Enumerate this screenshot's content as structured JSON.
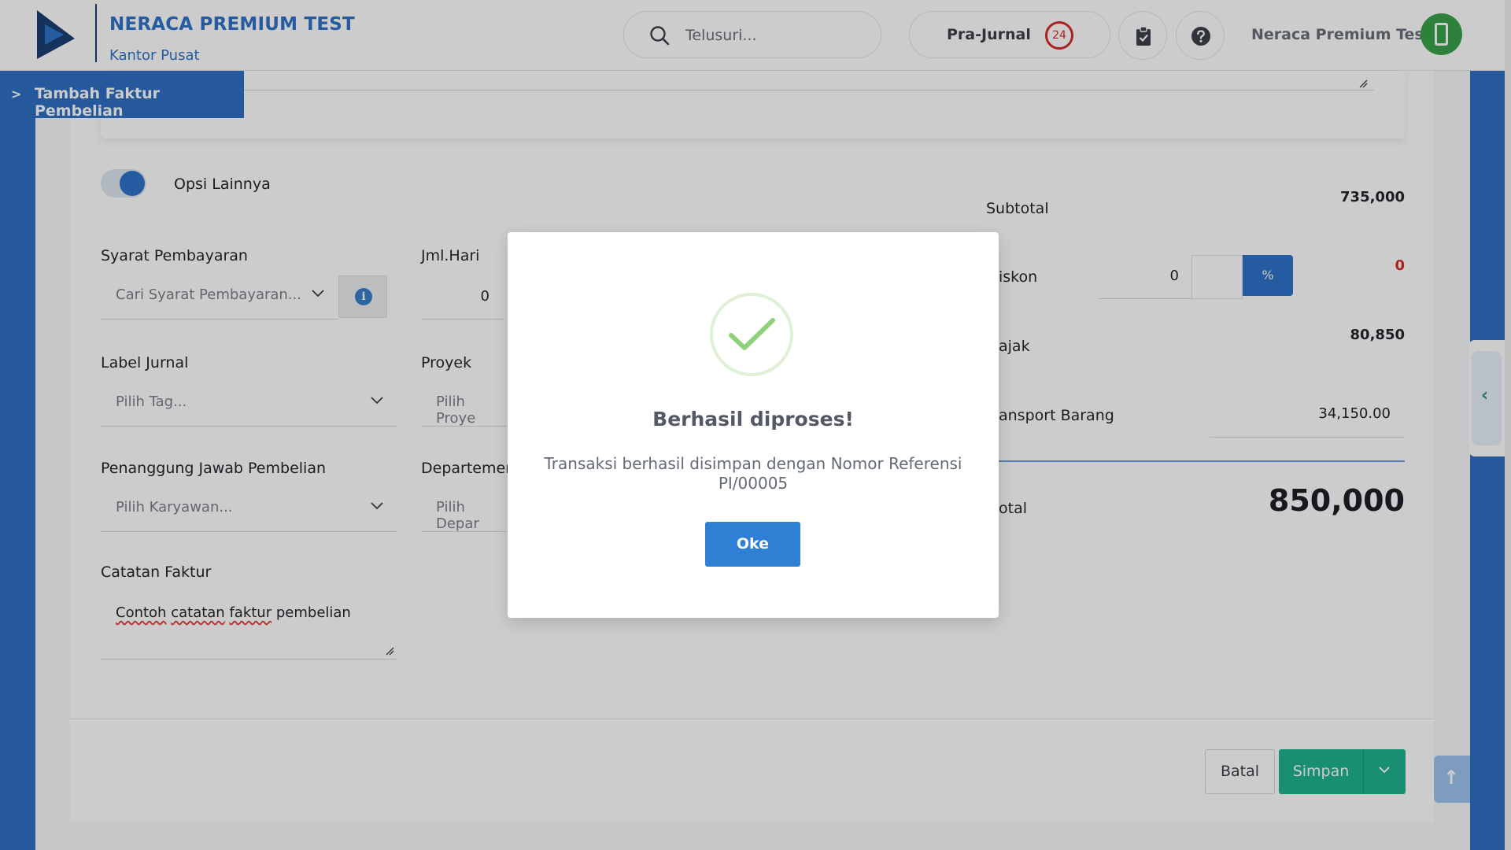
{
  "header": {
    "company_name": "NERACA PREMIUM TEST",
    "branch": "Kantor Pusat",
    "search_placeholder": "Telusuri...",
    "pre_journal_label": "Pra-Jurnal",
    "pre_journal_count": "24",
    "user_name": "Neraca Premium Test"
  },
  "page": {
    "breadcrumb_chevron": ">",
    "title": "Tambah Faktur Pembelian"
  },
  "form": {
    "other_options_label": "Opsi Lainnya",
    "payment_terms": {
      "label": "Syarat Pembayaran",
      "placeholder": "Cari Syarat Pembayaran...",
      "info_glyph": "i"
    },
    "days": {
      "label": "Jml.Hari",
      "value": "0"
    },
    "journal_label": {
      "label": "Label Jurnal",
      "placeholder": "Pilih Tag..."
    },
    "project": {
      "label": "Proyek",
      "placeholder": "Pilih Proye"
    },
    "purchaser": {
      "label": "Penanggung Jawab Pembelian",
      "placeholder": "Pilih Karyawan..."
    },
    "department": {
      "label": "Departemen",
      "placeholder": "Pilih Depar"
    },
    "invoice_notes": {
      "label": "Catatan Faktur",
      "word1": "Contoh",
      "word2": "catatan",
      "word3": "faktur",
      "word4": "pembelian"
    }
  },
  "summary": {
    "subtotal_label": "Subtotal",
    "subtotal_value": "735,000",
    "discount_label": "iskon",
    "discount_input": "0",
    "discount_unit": "%",
    "discount_value": "0",
    "tax_label": "ajak",
    "tax_value": "80,850",
    "transport_label": "ansport Barang",
    "transport_value": "34,150.00",
    "total_label": "otal",
    "total_value": "850,000"
  },
  "actions": {
    "cancel_label": "Batal",
    "save_label": "Simpan",
    "scroll_top_glyph": "↑",
    "collapse_glyph": "‹"
  },
  "modal": {
    "title": "Berhasil diproses!",
    "message": "Transaksi berhasil disimpan dengan Nomor Referensi PI/00005",
    "ok_label": "Oke"
  },
  "colors": {
    "brand_blue": "#2f70c4",
    "save_green": "#1fb28f",
    "badge_red": "#d52a2a",
    "success_green": "#8fd17a"
  }
}
